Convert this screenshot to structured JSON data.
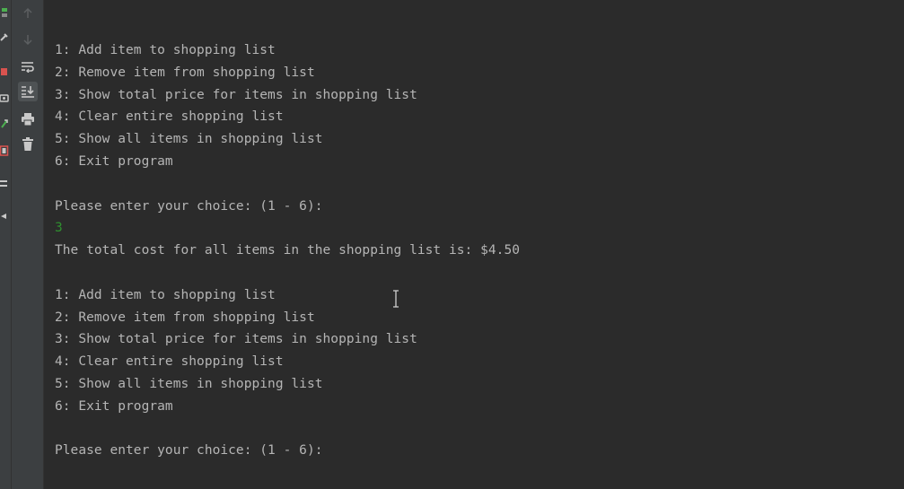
{
  "toolbar": {
    "buttons": [
      {
        "name": "up-arrow-icon"
      },
      {
        "name": "down-arrow-icon"
      },
      {
        "name": "soft-wrap-icon"
      },
      {
        "name": "scroll-to-end-icon"
      },
      {
        "name": "print-icon"
      },
      {
        "name": "trash-icon"
      }
    ]
  },
  "console": {
    "lines": [
      {
        "type": "output",
        "text": "1: Add item to shopping list"
      },
      {
        "type": "output",
        "text": "2: Remove item from shopping list"
      },
      {
        "type": "output",
        "text": "3: Show total price for items in shopping list"
      },
      {
        "type": "output",
        "text": "4: Clear entire shopping list"
      },
      {
        "type": "output",
        "text": "5: Show all items in shopping list"
      },
      {
        "type": "output",
        "text": "6: Exit program"
      },
      {
        "type": "blank",
        "text": ""
      },
      {
        "type": "output",
        "text": "Please enter your choice: (1 - 6):"
      },
      {
        "type": "input",
        "text": "3"
      },
      {
        "type": "output",
        "text": "The total cost for all items in the shopping list is: $4.50"
      },
      {
        "type": "blank",
        "text": ""
      },
      {
        "type": "output",
        "text": "1: Add item to shopping list"
      },
      {
        "type": "output",
        "text": "2: Remove item from shopping list"
      },
      {
        "type": "output",
        "text": "3: Show total price for items in shopping list"
      },
      {
        "type": "output",
        "text": "4: Clear entire shopping list"
      },
      {
        "type": "output",
        "text": "5: Show all items in shopping list"
      },
      {
        "type": "output",
        "text": "6: Exit program"
      },
      {
        "type": "blank",
        "text": ""
      },
      {
        "type": "output",
        "text": "Please enter your choice: (1 - 6):"
      }
    ]
  },
  "colors": {
    "console_bg": "#2b2b2b",
    "toolbar_bg": "#3c3f41",
    "output_text": "#b5b5b5",
    "input_text": "#2f8f2f"
  }
}
